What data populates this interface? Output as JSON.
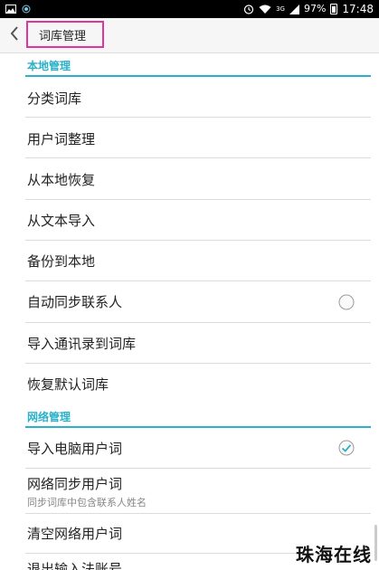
{
  "status_bar": {
    "battery": "97%",
    "time": "17:48",
    "network": "3G"
  },
  "header": {
    "title": "词库管理"
  },
  "sections": [
    {
      "title": "本地管理",
      "items": [
        {
          "label": "分类词库"
        },
        {
          "label": "用户词整理"
        },
        {
          "label": "从本地恢复"
        },
        {
          "label": "从文本导入"
        },
        {
          "label": "备份到本地"
        },
        {
          "label": "自动同步联系人",
          "toggle": "unchecked"
        },
        {
          "label": "导入通讯录到词库"
        },
        {
          "label": "恢复默认词库"
        }
      ]
    },
    {
      "title": "网络管理",
      "items": [
        {
          "label": "导入电脑用户词",
          "toggle": "checked"
        },
        {
          "label": "网络同步用户词",
          "sublabel": "同步词库中包含联系人姓名"
        },
        {
          "label": "清空网络用户词"
        },
        {
          "label": "退出输入法账号"
        }
      ]
    }
  ],
  "watermark": "珠海在线",
  "colors": {
    "accent": "#2ab0c8",
    "highlight": "#e0359a",
    "divider": "#dcdcdc",
    "text": "#222222",
    "subtext": "#888888"
  }
}
